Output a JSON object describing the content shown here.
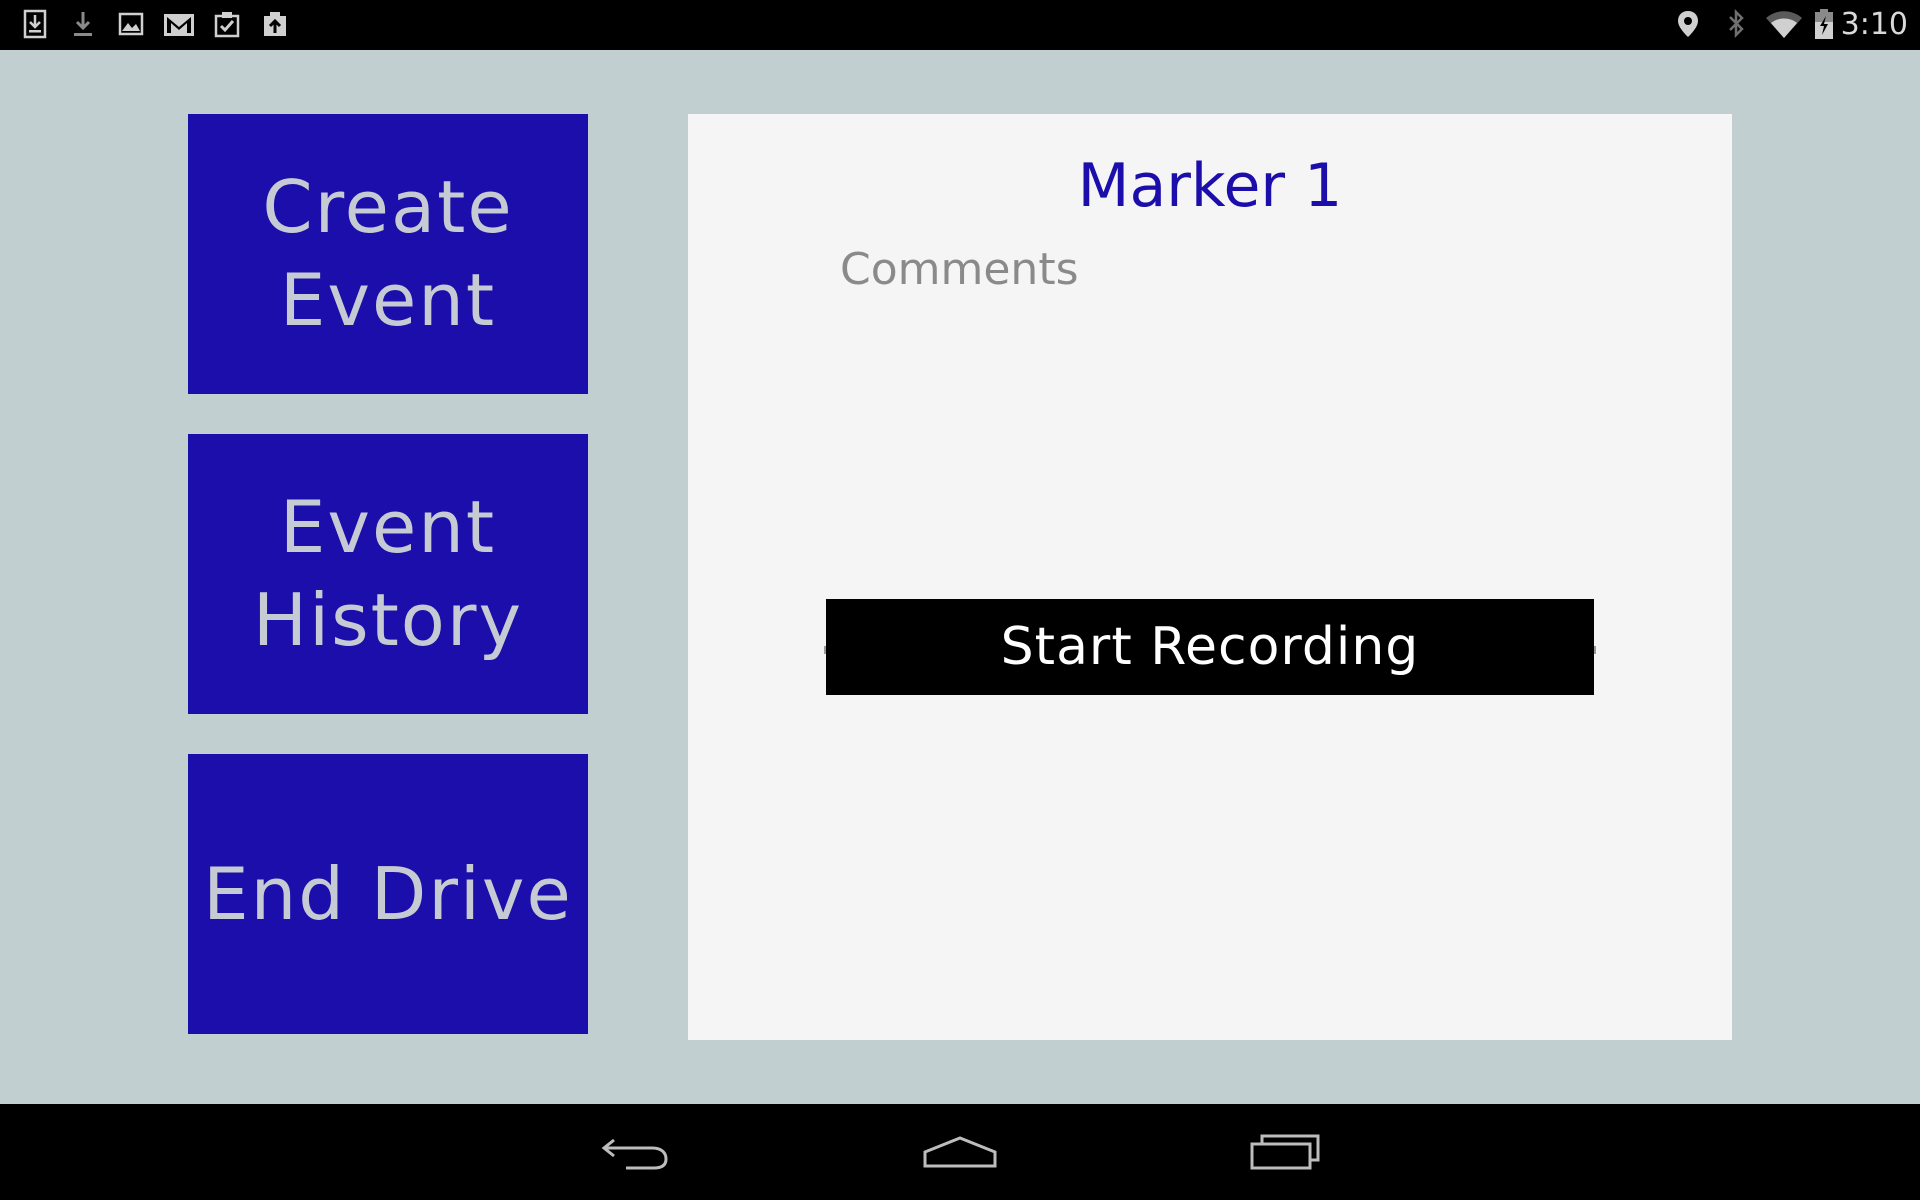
{
  "status_bar": {
    "time": "3:10",
    "left_icons": [
      "download-box-icon",
      "download-icon",
      "image-icon",
      "gmail-icon",
      "clipboard-check-icon",
      "clipboard-upload-icon"
    ],
    "right_icons": [
      "location-icon",
      "bluetooth-icon",
      "wifi-icon",
      "battery-charging-icon"
    ]
  },
  "sidebar": {
    "create_event": {
      "line1": "Create",
      "line2": "Event"
    },
    "event_history": {
      "line1": "Event",
      "line2": "History"
    },
    "end_drive": {
      "label": "End Drive"
    }
  },
  "panel": {
    "title": "Marker 1",
    "comments_placeholder": "Comments",
    "comments_value": "",
    "record_button": "Start Recording"
  },
  "nav_bar": {
    "icons": [
      "back-icon",
      "home-icon",
      "recent-apps-icon"
    ]
  },
  "colors": {
    "background": "#c2cfd0",
    "button_blue": "#1b0eaa",
    "button_text": "#c6cbd3",
    "panel": "#f5f5f5",
    "record_button": "#000000"
  }
}
